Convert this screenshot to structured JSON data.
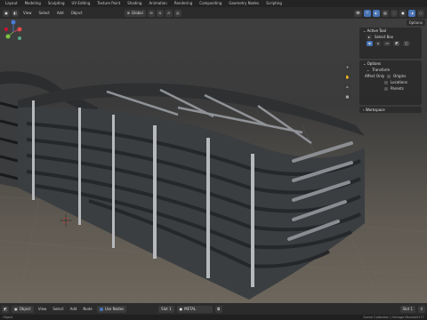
{
  "workspaces": [
    "Layout",
    "Modeling",
    "Sculpting",
    "UV Editing",
    "Texture Paint",
    "Shading",
    "Animation",
    "Rendering",
    "Compositing",
    "Geometry Nodes",
    "Scripting"
  ],
  "header": {
    "mode": "Global",
    "menus": [
      "View",
      "Select",
      "Add",
      "Object"
    ]
  },
  "options_label": "Options",
  "active_tool_panel": {
    "title": "Active Tool",
    "tool": "Select Box"
  },
  "options_panel": {
    "title": "Options",
    "transform": "Transform",
    "affect_only": "Affect Only",
    "items": [
      "Origins",
      "Locations",
      "Parents"
    ]
  },
  "workspace_panel": {
    "title": "Workspace"
  },
  "footer": {
    "mode": "Object",
    "menus": [
      "View",
      "Select",
      "Add",
      "Node"
    ],
    "use_nodes": "Use Nodes",
    "slot": "Slot 1",
    "material": "METAL",
    "slot_short": "Slot 1"
  },
  "status": {
    "left": "Object",
    "right": "Scene Collection | Vintage Module0177"
  },
  "colors": {
    "accent": "#4772b3",
    "gizmo_x": "#e04a4a",
    "gizmo_y": "#7cc43f",
    "gizmo_z": "#4a7bd9"
  }
}
